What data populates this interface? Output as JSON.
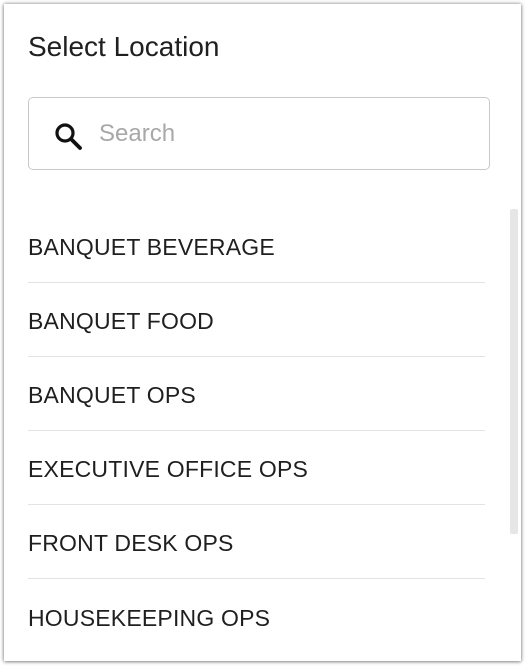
{
  "dialog": {
    "title": "Select Location"
  },
  "search": {
    "placeholder": "Search",
    "value": "",
    "icon": "search-icon"
  },
  "locations": [
    {
      "label": "BANQUET BEVERAGE"
    },
    {
      "label": "BANQUET FOOD"
    },
    {
      "label": "BANQUET OPS"
    },
    {
      "label": "EXECUTIVE OFFICE OPS"
    },
    {
      "label": "FRONT DESK OPS"
    },
    {
      "label": "HOUSEKEEPING OPS"
    }
  ]
}
